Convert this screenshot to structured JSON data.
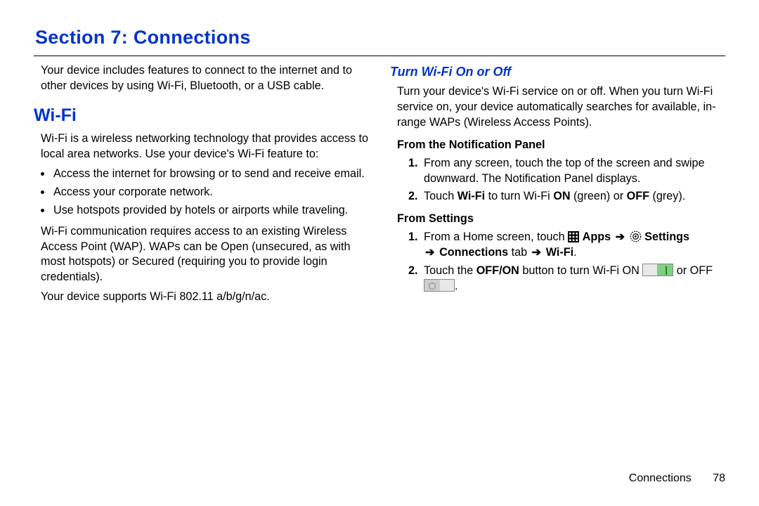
{
  "section_title": "Section 7: Connections",
  "left": {
    "intro": "Your device includes features to connect to the internet and to other devices by using Wi-Fi, Bluetooth, or a USB cable.",
    "wifi_heading": "Wi-Fi",
    "wifi_intro": "Wi-Fi is a wireless networking technology that provides access to local area networks. Use your device's Wi-Fi feature to:",
    "bullets": [
      "Access the internet for browsing or to send and receive email.",
      "Access your corporate network.",
      "Use hotspots provided by hotels or airports while traveling."
    ],
    "wap_para": "Wi-Fi communication requires access to an existing Wireless Access Point (WAP). WAPs can be Open (unsecured, as with most hotspots) or Secured (requiring you to provide login credentials).",
    "support_para": "Your device supports Wi-Fi 802.11 a/b/g/n/ac."
  },
  "right": {
    "h3": "Turn Wi-Fi On or Off",
    "intro": "Turn your device's Wi-Fi service on or off. When you turn Wi-Fi service on, your device automatically searches for available, in-range WAPs (Wireless Access Points).",
    "notif_heading": "From the Notification Panel",
    "notif_steps": {
      "s1": "From any screen, touch the top of the screen and swipe downward. The Notification Panel displays.",
      "s2_pre": "Touch ",
      "s2_b1": "Wi-Fi",
      "s2_mid": " to turn Wi-Fi ",
      "s2_b2": "ON",
      "s2_after2": " (green) or ",
      "s2_b3": "OFF",
      "s2_end": " (grey)."
    },
    "settings_heading": "From Settings",
    "settings_steps": {
      "s1_pre": "From a Home screen, touch ",
      "s1_apps": "Apps",
      "s1_settings": "Settings",
      "s1_conn": "Connections",
      "s1_tab": " tab ",
      "s1_wifi": "Wi-Fi",
      "s1_period": ".",
      "s2_pre": "Touch the ",
      "s2_b": "OFF/ON",
      "s2_mid": " button to turn Wi-Fi ON ",
      "s2_or": " or OFF ",
      "s2_end": "."
    }
  },
  "arrow": "➔",
  "footer": {
    "section": "Connections",
    "page": "78"
  }
}
